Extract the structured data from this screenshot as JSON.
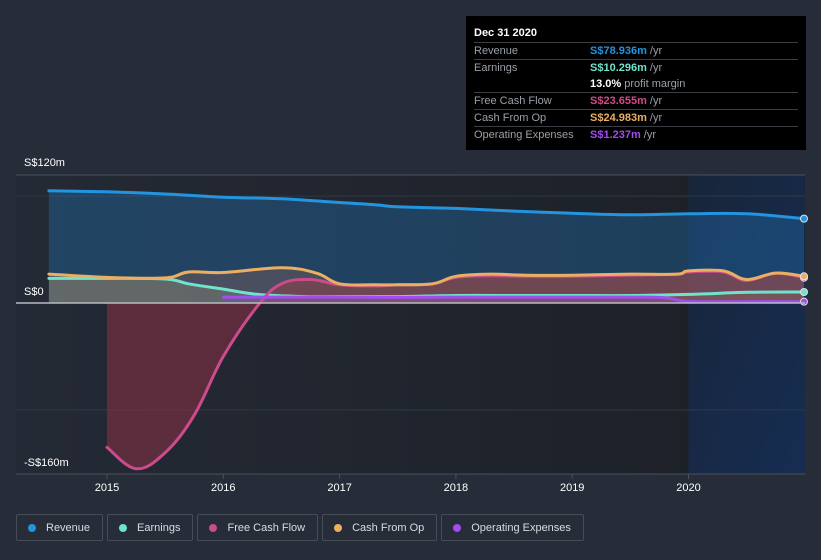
{
  "tooltip": {
    "date": "Dec 31 2020",
    "rows": [
      {
        "label": "Revenue",
        "value": "S$78.936m",
        "unit": "/yr",
        "color": "#2394df"
      },
      {
        "label": "Earnings",
        "value": "S$10.296m",
        "unit": "/yr",
        "color": "#6fe3cc"
      },
      {
        "label": "",
        "value": "13.0%",
        "unit": "profit margin",
        "color": "#ffffff"
      },
      {
        "label": "Free Cash Flow",
        "value": "S$23.655m",
        "unit": "/yr",
        "color": "#cc4b8b"
      },
      {
        "label": "Cash From Op",
        "value": "S$24.983m",
        "unit": "/yr",
        "color": "#eaaf61"
      },
      {
        "label": "Operating Expenses",
        "value": "S$1.237m",
        "unit": "/yr",
        "color": "#a04ef0"
      }
    ]
  },
  "legend": [
    {
      "label": "Revenue",
      "color": "#2394df"
    },
    {
      "label": "Earnings",
      "color": "#6fe3cc"
    },
    {
      "label": "Free Cash Flow",
      "color": "#cc4b8b"
    },
    {
      "label": "Cash From Op",
      "color": "#eaaf61"
    },
    {
      "label": "Operating Expenses",
      "color": "#a04ef0"
    }
  ],
  "chart_data": {
    "type": "area",
    "title": "",
    "xlabel": "",
    "ylabel": "",
    "currency_unit": "S$ millions",
    "xlim": [
      2014.2,
      2021.0
    ],
    "ylim": [
      -160,
      120
    ],
    "y_ticks": [
      {
        "value": 120,
        "label": "S$120m"
      },
      {
        "value": 0,
        "label": "S$0"
      },
      {
        "value": -160,
        "label": "-S$160m"
      }
    ],
    "x_ticks": [
      {
        "value": 2015,
        "label": "2015"
      },
      {
        "value": 2016,
        "label": "2016"
      },
      {
        "value": 2017,
        "label": "2017"
      },
      {
        "value": 2018,
        "label": "2018"
      },
      {
        "value": 2019,
        "label": "2019"
      },
      {
        "value": 2020,
        "label": "2020"
      }
    ],
    "gridlines": [
      100,
      -100
    ],
    "highlight_region": [
      2020.0,
      2021.0
    ],
    "legend_position": "bottom",
    "series": [
      {
        "name": "Revenue",
        "color": "#2394df",
        "fill": true,
        "points": [
          [
            2014.5,
            105
          ],
          [
            2015.0,
            104
          ],
          [
            2015.5,
            102
          ],
          [
            2016.0,
            99
          ],
          [
            2016.5,
            97.5
          ],
          [
            2017.0,
            94
          ],
          [
            2017.3,
            92
          ],
          [
            2017.5,
            90
          ],
          [
            2018.0,
            88.5
          ],
          [
            2018.5,
            86
          ],
          [
            2019.0,
            84
          ],
          [
            2019.5,
            82.5
          ],
          [
            2020.0,
            83.5
          ],
          [
            2020.5,
            83.5
          ],
          [
            2021.0,
            78.936
          ]
        ]
      },
      {
        "name": "Earnings",
        "color": "#6fe3cc",
        "fill": true,
        "points": [
          [
            2014.5,
            23
          ],
          [
            2015.0,
            23
          ],
          [
            2015.5,
            22.5
          ],
          [
            2015.7,
            18
          ],
          [
            2016.0,
            13
          ],
          [
            2016.3,
            8
          ],
          [
            2016.7,
            6
          ],
          [
            2017.0,
            6
          ],
          [
            2017.5,
            6
          ],
          [
            2018.0,
            7
          ],
          [
            2018.5,
            7
          ],
          [
            2019.0,
            7
          ],
          [
            2019.5,
            7
          ],
          [
            2020.0,
            8
          ],
          [
            2020.5,
            10
          ],
          [
            2021.0,
            10.296
          ]
        ]
      },
      {
        "name": "Free Cash Flow",
        "color": "#cc4b8b",
        "fill": true,
        "points": [
          [
            2015.0,
            -135
          ],
          [
            2015.25,
            -155
          ],
          [
            2015.5,
            -140
          ],
          [
            2015.75,
            -105
          ],
          [
            2016.0,
            -50
          ],
          [
            2016.3,
            -2
          ],
          [
            2016.5,
            18
          ],
          [
            2016.75,
            22
          ],
          [
            2017.0,
            17
          ],
          [
            2017.3,
            16
          ],
          [
            2017.5,
            17
          ],
          [
            2017.8,
            18
          ],
          [
            2018.0,
            24
          ],
          [
            2018.3,
            25.5
          ],
          [
            2018.6,
            25
          ],
          [
            2019.0,
            25
          ],
          [
            2019.5,
            26
          ],
          [
            2019.9,
            27
          ],
          [
            2020.0,
            29
          ],
          [
            2020.3,
            29
          ],
          [
            2020.5,
            21
          ],
          [
            2020.75,
            28
          ],
          [
            2021.0,
            23.655
          ]
        ]
      },
      {
        "name": "Cash From Op",
        "color": "#eaaf61",
        "fill": true,
        "points": [
          [
            2014.5,
            27
          ],
          [
            2015.0,
            24
          ],
          [
            2015.5,
            23.5
          ],
          [
            2015.7,
            29
          ],
          [
            2016.0,
            28.5
          ],
          [
            2016.5,
            33
          ],
          [
            2016.8,
            28
          ],
          [
            2017.0,
            18
          ],
          [
            2017.3,
            17
          ],
          [
            2017.5,
            17
          ],
          [
            2017.8,
            18
          ],
          [
            2018.0,
            25
          ],
          [
            2018.3,
            27
          ],
          [
            2018.6,
            26
          ],
          [
            2019.0,
            26
          ],
          [
            2019.5,
            27
          ],
          [
            2019.9,
            27
          ],
          [
            2020.0,
            30
          ],
          [
            2020.3,
            30
          ],
          [
            2020.5,
            22
          ],
          [
            2020.75,
            28
          ],
          [
            2021.0,
            24.983
          ]
        ]
      },
      {
        "name": "Operating Expenses",
        "color": "#a04ef0",
        "fill": true,
        "points": [
          [
            2016.0,
            5.5
          ],
          [
            2016.5,
            5.5
          ],
          [
            2017.0,
            5.5
          ],
          [
            2017.5,
            5.2
          ],
          [
            2018.0,
            5.5
          ],
          [
            2018.5,
            5.5
          ],
          [
            2019.0,
            5.5
          ],
          [
            2019.5,
            5.5
          ],
          [
            2019.8,
            5.0
          ],
          [
            2020.0,
            1.5
          ],
          [
            2020.5,
            1.3
          ],
          [
            2021.0,
            1.237
          ]
        ]
      }
    ]
  }
}
